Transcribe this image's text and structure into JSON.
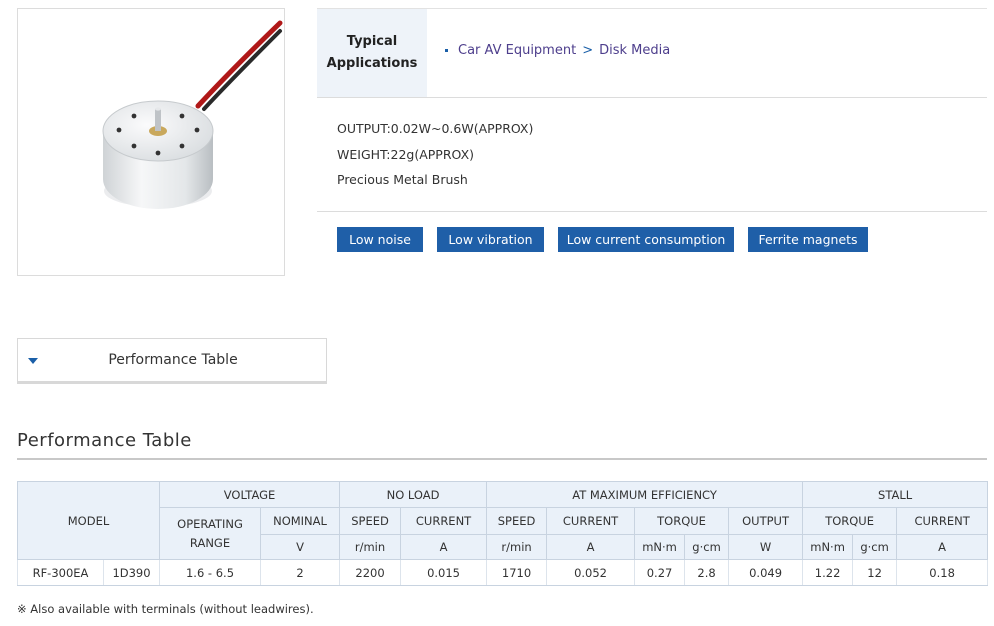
{
  "applications": {
    "label_line1": "Typical",
    "label_line2": "Applications",
    "crumb_parent": "Car AV Equipment",
    "crumb_separator": ">",
    "crumb_child": "Disk Media"
  },
  "specs": {
    "output": "OUTPUT:0.02W~0.6W(APPROX)",
    "weight": "WEIGHT:22g(APPROX)",
    "brush": "Precious Metal Brush"
  },
  "features": [
    "Low noise",
    "Low vibration",
    "Low current consumption",
    "Ferrite magnets"
  ],
  "accordion": {
    "title": "Performance Table"
  },
  "section_title": "Performance Table",
  "table": {
    "headers": {
      "model": "MODEL",
      "voltage": "VOLTAGE",
      "no_load": "NO LOAD",
      "max_eff": "AT MAXIMUM EFFICIENCY",
      "stall": "STALL",
      "operating_range_l1": "OPERATING",
      "operating_range_l2": "RANGE",
      "nominal": "NOMINAL",
      "nl_speed": "SPEED",
      "nl_current": "CURRENT",
      "me_speed": "SPEED",
      "me_current": "CURRENT",
      "me_torque": "TORQUE",
      "me_output": "OUTPUT",
      "st_torque": "TORQUE",
      "st_current": "CURRENT"
    },
    "units": {
      "nominal": "V",
      "nl_speed": "r/min",
      "nl_current": "A",
      "me_speed": "r/min",
      "me_current": "A",
      "me_torque_mnm": "mN·m",
      "me_torque_gcm": "g·cm",
      "me_output": "W",
      "st_torque_mnm": "mN·m",
      "st_torque_gcm": "g·cm",
      "st_current": "A"
    },
    "rows": [
      {
        "model": "RF-300EA",
        "variant": "1D390",
        "operating_range": "1.6 - 6.5",
        "nominal": "2",
        "nl_speed": "2200",
        "nl_current": "0.015",
        "me_speed": "1710",
        "me_current": "0.052",
        "me_torque_mnm": "0.27",
        "me_torque_gcm": "2.8",
        "me_output": "0.049",
        "st_torque_mnm": "1.22",
        "st_torque_gcm": "12",
        "st_current": "0.18"
      }
    ]
  },
  "footnote": "※ Also available with terminals (without leadwires).",
  "colors": {
    "accent": "#1f5fa8",
    "header_bg": "#eaf1f9",
    "crumb": "#4d3e8c"
  }
}
